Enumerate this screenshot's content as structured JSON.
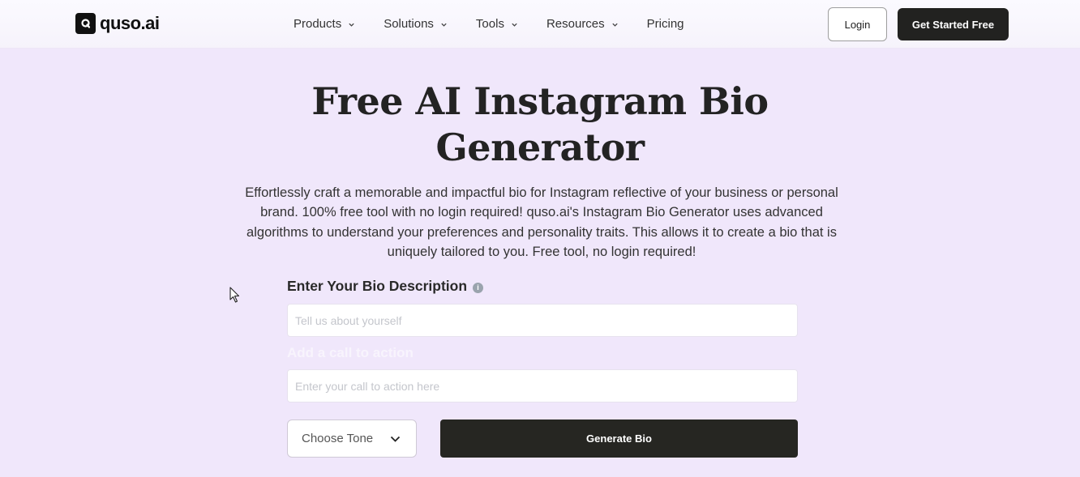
{
  "header": {
    "logo_text": "quso.ai",
    "nav": [
      {
        "label": "Products",
        "has_dropdown": true
      },
      {
        "label": "Solutions",
        "has_dropdown": true
      },
      {
        "label": "Tools",
        "has_dropdown": true
      },
      {
        "label": "Resources",
        "has_dropdown": true
      },
      {
        "label": "Pricing",
        "has_dropdown": false
      }
    ],
    "login_label": "Login",
    "cta_label": "Get Started Free"
  },
  "hero": {
    "title": "Free AI Instagram Bio Generator",
    "description": "Effortlessly craft a memorable and impactful bio for Instagram reflective of your business or personal brand. 100% free tool with no login required! quso.ai's Instagram Bio Generator uses advanced algorithms to understand your preferences and personality traits. This allows it to create a bio that is uniquely tailored to you. Free tool, no login required!"
  },
  "form": {
    "bio_label": "Enter Your Bio Description",
    "bio_info_icon": "info-icon",
    "bio_placeholder": "Tell us about yourself",
    "bio_value": "",
    "cta_label": "Add a call to action",
    "cta_placeholder": "Enter your call to action here",
    "cta_value": "",
    "tone_selected": "Choose Tone",
    "generate_label": "Generate Bio"
  },
  "colors": {
    "background": "#f0e7fb",
    "primary_button": "#222220",
    "header_bg": "#f8f6fc"
  }
}
